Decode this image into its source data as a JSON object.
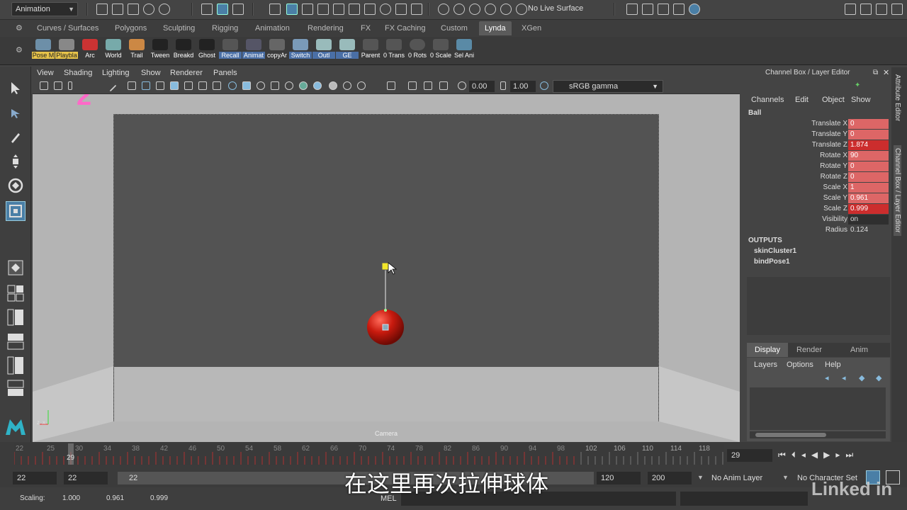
{
  "app": {
    "mode": "Animation",
    "live_surface": "No Live Surface"
  },
  "shelf_tabs": [
    "Curves / Surfaces",
    "Polygons",
    "Sculpting",
    "Rigging",
    "Animation",
    "Rendering",
    "FX",
    "FX Caching",
    "Custom",
    "Lynda",
    "XGen"
  ],
  "active_shelf_tab": "Lynda",
  "shelf_buttons": [
    "Pose M",
    "Playbla",
    "Arc",
    "World",
    "Trail",
    "Tween",
    "Breakd",
    "Ghost",
    "Recall",
    "Animat",
    "copyAr",
    "Switch",
    "Outl",
    "GE",
    "Parent",
    "0 Trans",
    "0 Rots",
    "0 Scale",
    "Sel Ani"
  ],
  "panel_menu": [
    "View",
    "Shading",
    "Lighting",
    "Show",
    "Renderer",
    "Panels"
  ],
  "panel_toolbar": {
    "value1": "0.00",
    "value2": "1.00",
    "color_space": "sRGB gamma"
  },
  "viewport": {
    "camera_label": "Camera",
    "annotation": "2"
  },
  "channel_box": {
    "title": "Channel Box / Layer Editor",
    "menu": [
      "Channels",
      "Edit",
      "Object",
      "Show"
    ],
    "object": "Ball",
    "attributes": [
      {
        "name": "Translate X",
        "value": "0"
      },
      {
        "name": "Translate Y",
        "value": "0"
      },
      {
        "name": "Translate Z",
        "value": "1.874"
      },
      {
        "name": "Rotate X",
        "value": "90"
      },
      {
        "name": "Rotate Y",
        "value": "0"
      },
      {
        "name": "Rotate Z",
        "value": "0"
      },
      {
        "name": "Scale X",
        "value": "1"
      },
      {
        "name": "Scale Y",
        "value": "0.961"
      },
      {
        "name": "Scale Z",
        "value": "0.999"
      },
      {
        "name": "Visibility",
        "value": "on"
      },
      {
        "name": "Radius",
        "value": "0.124"
      }
    ],
    "outputs_label": "OUTPUTS",
    "outputs": [
      "skinCluster1",
      "bindPose1"
    ],
    "layer_tabs": [
      "Display",
      "Render",
      "Anim"
    ],
    "layer_menu": [
      "Layers",
      "Options",
      "Help"
    ]
  },
  "side_tabs": [
    "Attribute Editor",
    "Channel Box / Layer Editor"
  ],
  "timeline": {
    "tick_labels": [
      "22",
      "25",
      "29",
      "30",
      "34",
      "38",
      "42",
      "46",
      "50",
      "54",
      "58",
      "62",
      "66",
      "70",
      "74",
      "78",
      "82",
      "86",
      "90",
      "94",
      "98",
      "102",
      "106",
      "110",
      "114",
      "118"
    ],
    "current_frame": "29"
  },
  "range": {
    "start": "22",
    "inner_start": "22",
    "slider": "22",
    "inner_end": "120",
    "end": "200",
    "anim_layer": "No Anim Layer",
    "char_set": "No Character Set"
  },
  "status": {
    "label": "Scaling:",
    "x": "1.000",
    "y": "0.961",
    "z": "0.999",
    "lang": "MEL"
  },
  "subtitle": "在这里再次拉伸球体",
  "watermark": "Linked in"
}
